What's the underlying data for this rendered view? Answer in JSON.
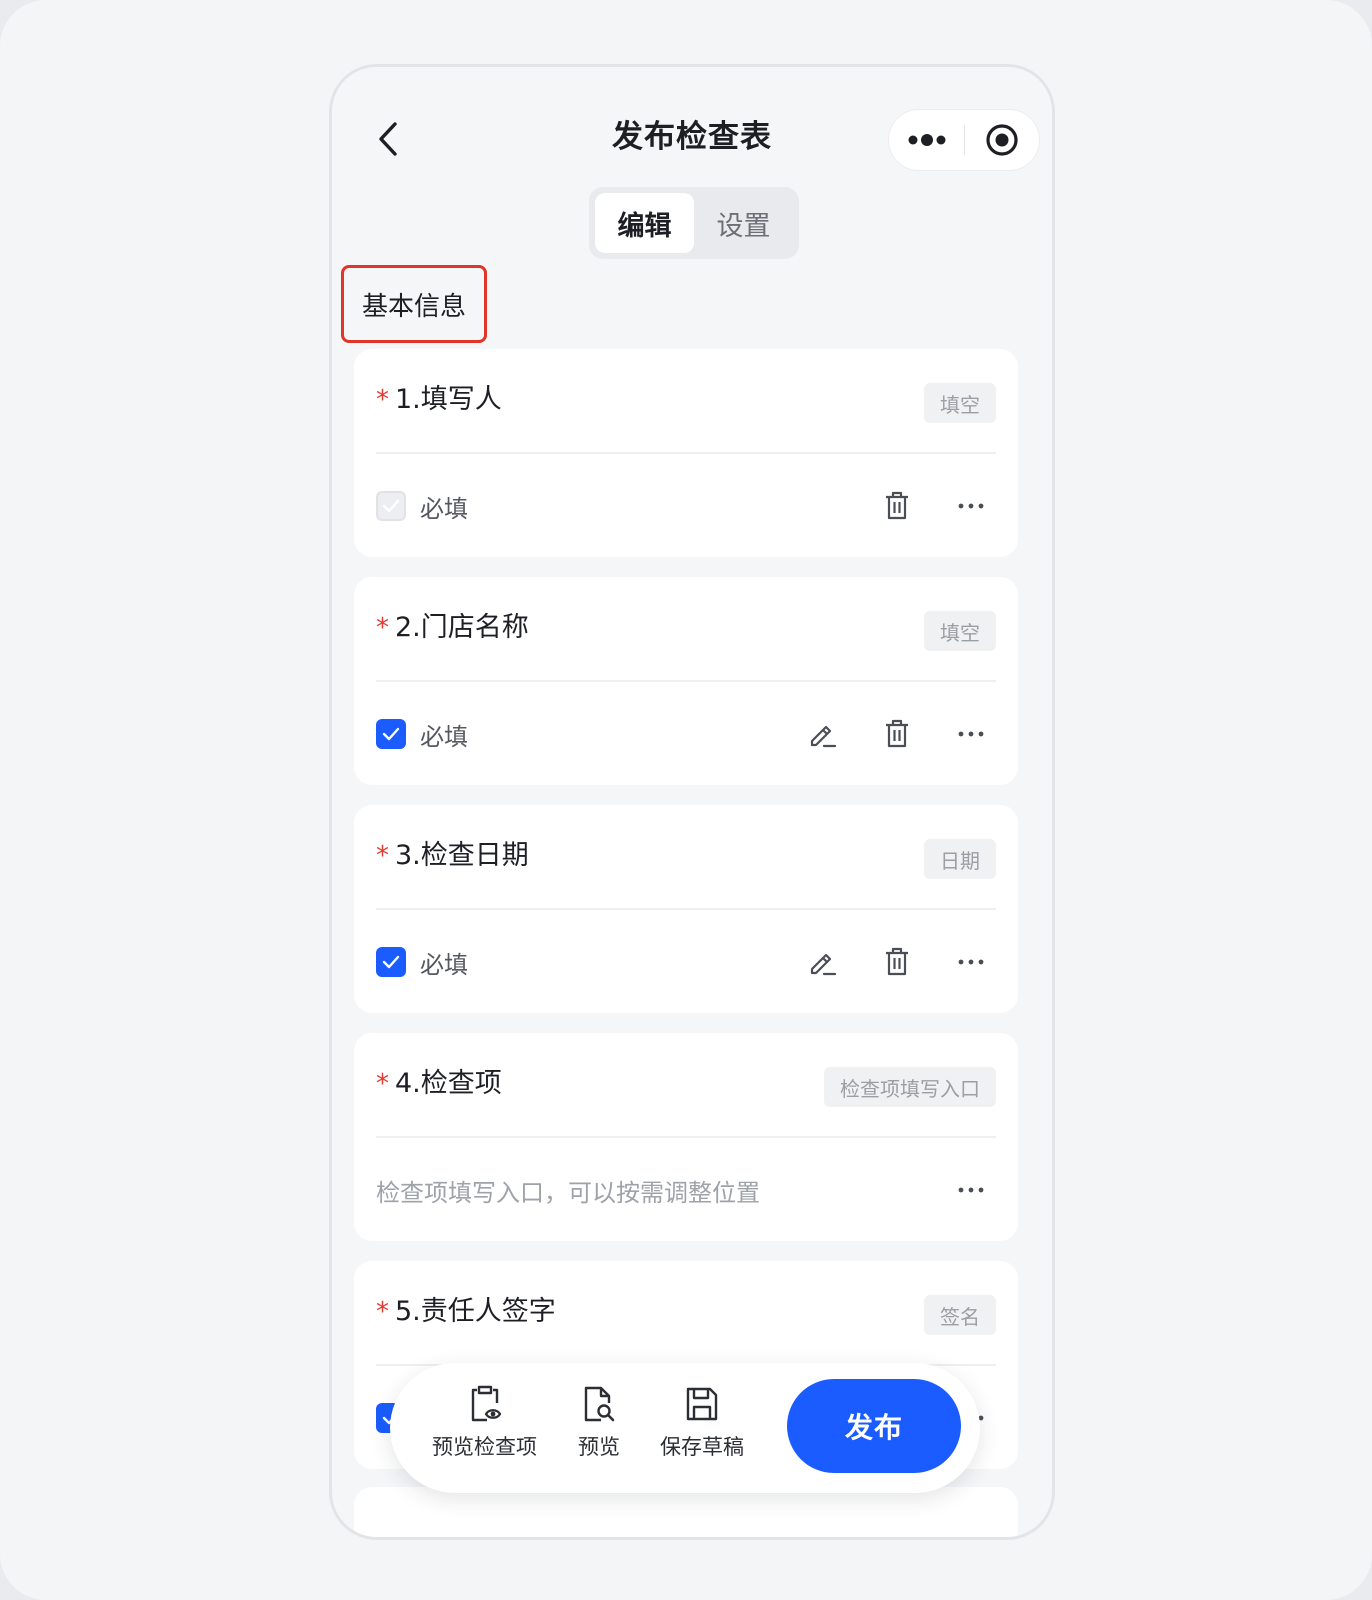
{
  "header": {
    "title": "发布检查表",
    "back_icon": "chevron-left-icon",
    "more_icon": "ellipsis-icon",
    "close_icon": "target-circle-icon"
  },
  "tabs": [
    {
      "label": "编辑",
      "active": true
    },
    {
      "label": "设置",
      "active": false
    }
  ],
  "section": {
    "label": "基本信息"
  },
  "questions": [
    {
      "star": "*",
      "label": "1.填写人",
      "type_tag": "填空",
      "required_checked": true,
      "required_disabled": true,
      "required_label": "必填",
      "show_edit": false
    },
    {
      "star": "*",
      "label": "2.门店名称",
      "type_tag": "填空",
      "required_checked": true,
      "required_disabled": false,
      "required_label": "必填",
      "show_edit": true
    },
    {
      "star": "*",
      "label": "3.检查日期",
      "type_tag": "日期",
      "required_checked": true,
      "required_disabled": false,
      "required_label": "必填",
      "show_edit": true
    },
    {
      "star": "*",
      "label": "4.检查项",
      "type_tag": "检查项填写入口",
      "hint": "检查项填写入口，可以按需调整位置"
    },
    {
      "star": "*",
      "label": "5.责任人签字",
      "type_tag": "签名",
      "required_checked": true
    }
  ],
  "bottom_bar": {
    "items": [
      {
        "label": "预览检查项",
        "icon": "clipboard-eye-icon"
      },
      {
        "label": "预览",
        "icon": "document-search-icon"
      },
      {
        "label": "保存草稿",
        "icon": "floppy-disk-icon"
      }
    ],
    "publish_label": "发布"
  },
  "colors": {
    "accent": "#1a5cff",
    "required_star": "#e5392f",
    "highlight_border": "#e0352b",
    "background": "#f5f6f8"
  }
}
